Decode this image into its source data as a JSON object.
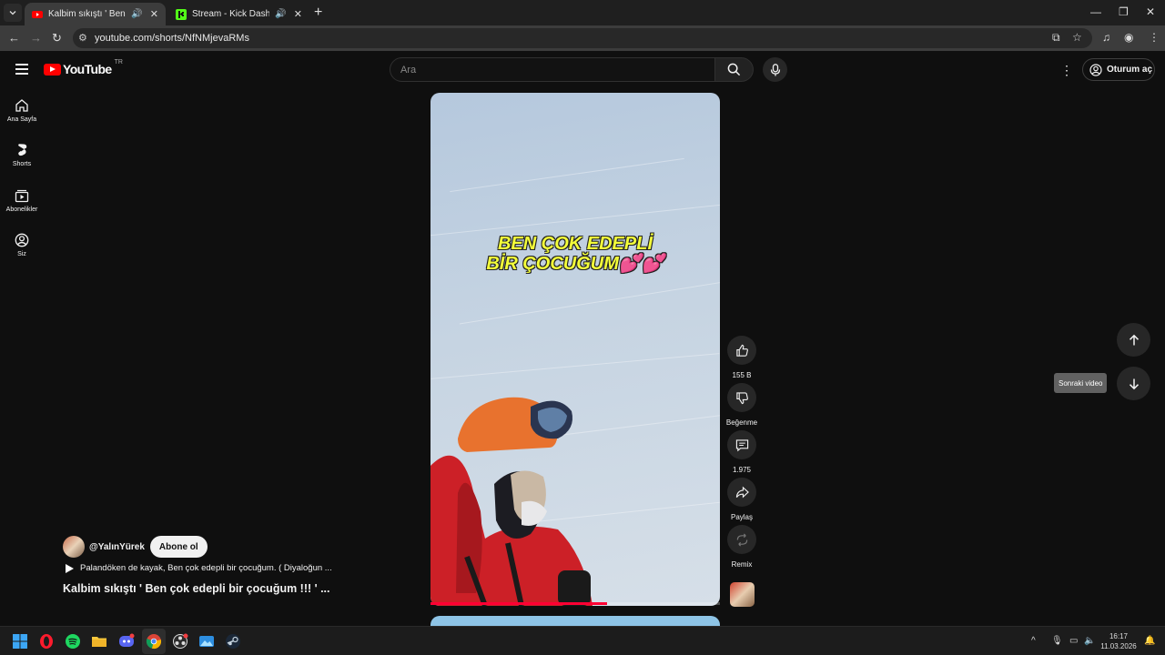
{
  "browser": {
    "tabs": [
      {
        "title": "Kalbim sıkıştı ' Ben çok edepli",
        "active": true
      },
      {
        "title": "Stream - Kick Dashboard",
        "active": false
      }
    ],
    "url": "youtube.com/shorts/NfNMjevaRMs"
  },
  "youtube": {
    "logo_text": "YouTube",
    "country_code": "TR",
    "search_placeholder": "Ara",
    "signin_label": "Oturum aç",
    "sidebar": [
      {
        "label": "Ana Sayfa",
        "icon": "home-icon"
      },
      {
        "label": "Shorts",
        "icon": "shorts-icon"
      },
      {
        "label": "Abonelikler",
        "icon": "subscriptions-icon"
      },
      {
        "label": "Siz",
        "icon": "you-icon"
      }
    ],
    "short": {
      "caption_line1": "BEN ÇOK EDEPLİ",
      "caption_line2": "BİR ÇOCUĞUM💕💕",
      "progress": 0.61,
      "channel": "@YalınYürek",
      "subscribe_label": "Abone ol",
      "description": "Palandöken de kayak, Ben çok edepli bir çocuğum. ( Diyaloğun ...",
      "title": "Kalbim sıkıştı ' Ben çok edepli bir çocuğum !!! ' ..."
    },
    "actions": {
      "likes": "155 B",
      "dislike_label": "Beğenme",
      "comments": "1.975",
      "share_label": "Paylaş",
      "remix_label": "Remix"
    },
    "next_tooltip": "Sonraki video"
  },
  "taskbar": {
    "time": "16:17",
    "date": "11.03.2026"
  },
  "colors": {
    "youtube_red": "#ff0000",
    "progress": "#ff0033",
    "caption": "#f4ff3a",
    "background": "#0f0f0f"
  }
}
